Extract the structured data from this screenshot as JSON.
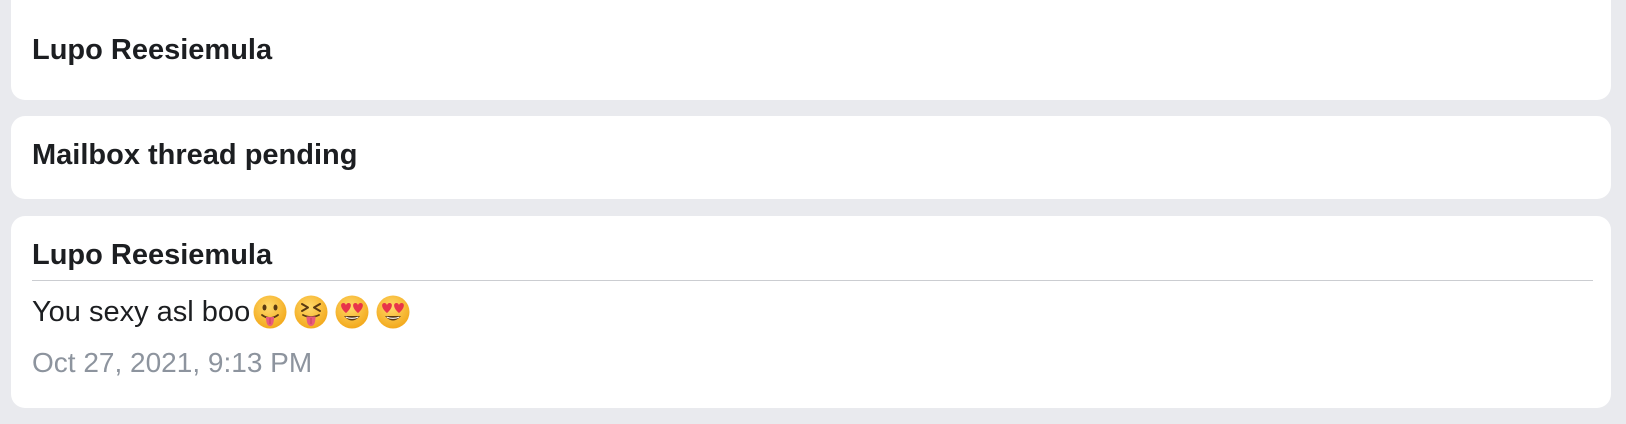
{
  "threads": [
    {
      "title": "Lupo Reesiemula"
    },
    {
      "title": "Mailbox thread pending"
    }
  ],
  "message": {
    "sender": "Lupo Reesiemula",
    "text": "You sexy asl boo",
    "emojis": [
      "face-with-tongue-icon",
      "squinting-face-with-tongue-icon",
      "heart-eyes-icon",
      "heart-eyes-icon"
    ],
    "timestamp": "Oct 27, 2021, 9:13 PM"
  },
  "colors": {
    "page_background": "#e9eaee",
    "card_background": "#ffffff",
    "text_primary": "#1c1e21",
    "text_secondary": "#8d949e",
    "divider": "#cbcdd1",
    "emoji_face": "#f7b733",
    "emoji_tongue": "#e95b7b",
    "emoji_heart": "#e8344a"
  }
}
